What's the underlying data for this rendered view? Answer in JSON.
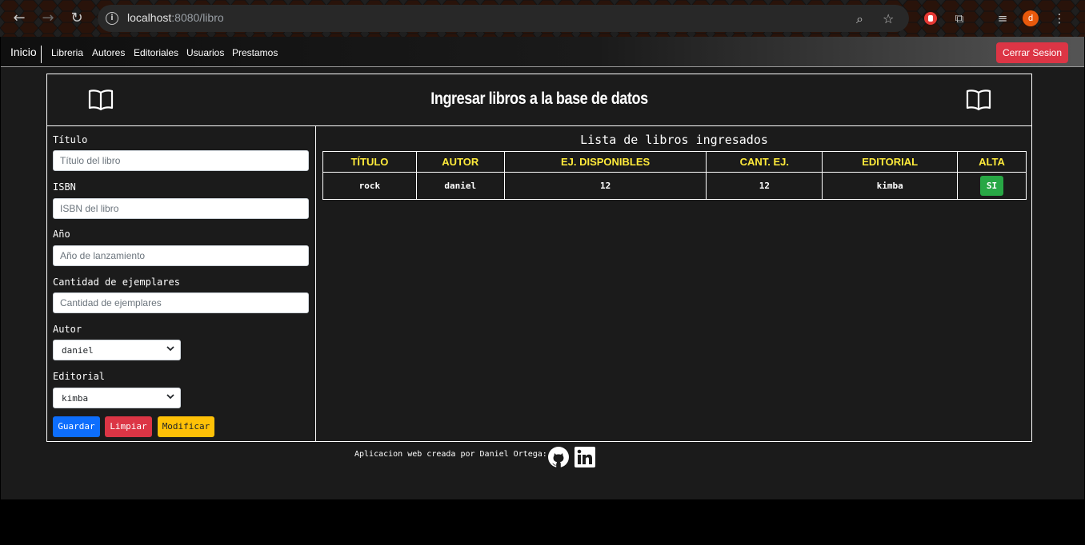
{
  "browser": {
    "url_host": "localhost",
    "url_path": ":8080/libro",
    "avatar_letter": "d"
  },
  "navbar": {
    "brand": "Inicio",
    "links": [
      "Libreria",
      "Autores",
      "Editoriales",
      "Usuarios",
      "Prestamos"
    ],
    "logout_label": "Cerrar Sesion"
  },
  "header": {
    "title": "Ingresar libros a la base de datos"
  },
  "form": {
    "titulo": {
      "label": "Título",
      "placeholder": "Título del libro"
    },
    "isbn": {
      "label": "ISBN",
      "placeholder": "ISBN del libro"
    },
    "anio": {
      "label": "Año",
      "placeholder": "Año de lanzamiento"
    },
    "cantidad": {
      "label": "Cantidad de ejemplares",
      "placeholder": "Cantidad de ejemplares"
    },
    "autor": {
      "label": "Autor",
      "selected": "daniel"
    },
    "editorial": {
      "label": "Editorial",
      "selected": "kimba"
    },
    "buttons": {
      "save": "Guardar",
      "clear": "Limpiar",
      "modify": "Modificar"
    }
  },
  "list": {
    "title": "Lista de libros ingresados",
    "columns": [
      "TÍTULO",
      "AUTOR",
      "EJ. DISPONIBLES",
      "CANT. EJ.",
      "EDITORIAL",
      "ALTA"
    ],
    "rows": [
      {
        "titulo": "rock",
        "autor": "daniel",
        "disponibles": "12",
        "cantidad": "12",
        "editorial": "kimba",
        "alta": "SI"
      }
    ]
  },
  "footer": {
    "text": "Aplicacion web creada por Daniel Ortega:"
  },
  "colors": {
    "danger": "#dc3545",
    "primary": "#0d6efd",
    "warning": "#ffc107",
    "success": "#28a745",
    "table_header": "#ffeb3b"
  }
}
